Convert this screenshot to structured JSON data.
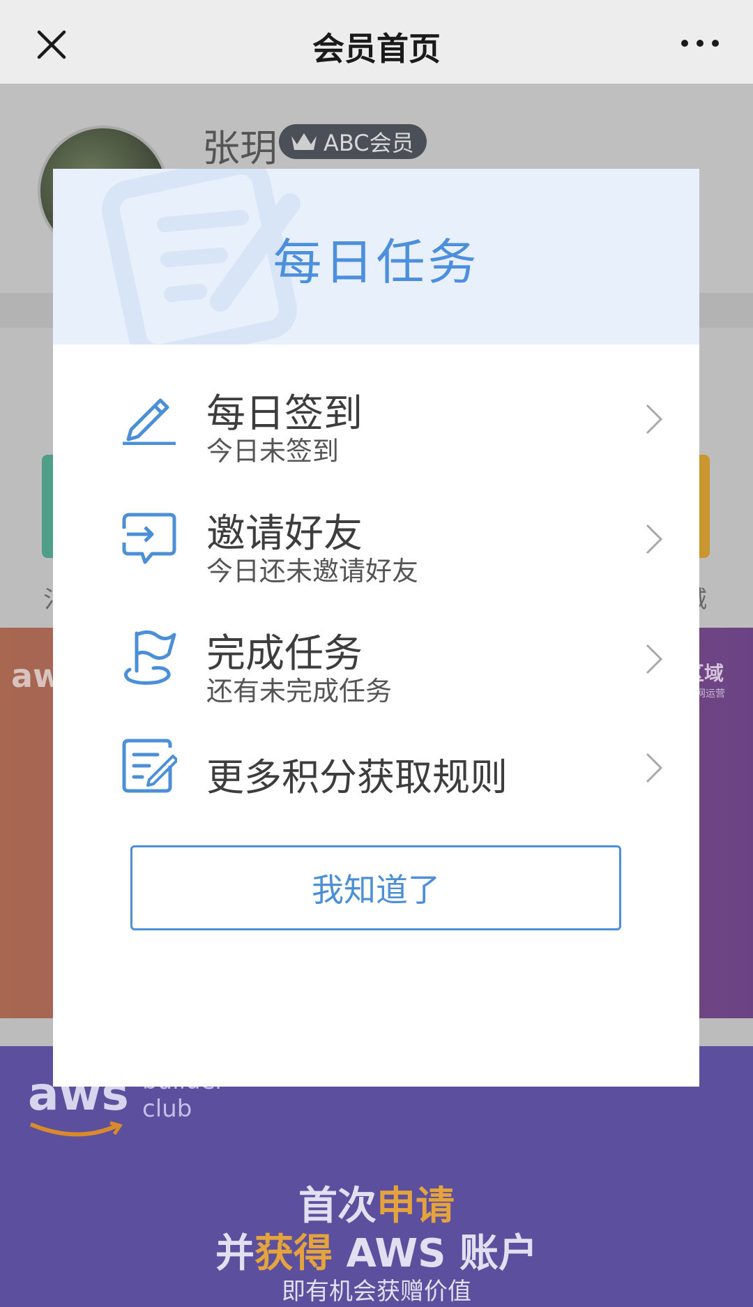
{
  "nav": {
    "title": "会员首页"
  },
  "profile": {
    "name": "张玥",
    "badge": "ABC会员"
  },
  "shortcuts": {
    "left_peek": "氵",
    "right_peek": "城"
  },
  "banner1": {
    "brand": "aws",
    "region_label": "区域",
    "region_sub": "网运营"
  },
  "banner2": {
    "brand": "aws",
    "brand_sub": "builder\nclub",
    "line1_a": "首次",
    "line1_b": "申请",
    "line2_a": "并",
    "line2_b": "获得",
    "line2_c": " AWS 账户",
    "line3": "即有机会获赠价值"
  },
  "modal": {
    "title": "每日任务",
    "tasks": [
      {
        "title": "每日签到",
        "desc": "今日未签到",
        "icon": "pencil-icon"
      },
      {
        "title": "邀请好友",
        "desc": "今日还未邀请好友",
        "icon": "share-icon"
      },
      {
        "title": "完成任务",
        "desc": "还有未完成任务",
        "icon": "flag-icon"
      },
      {
        "title": "更多积分获取规则",
        "desc": "",
        "icon": "edit-note-icon"
      }
    ],
    "ok_button": "我知道了"
  },
  "colors": {
    "accent": "#4b8fd6",
    "header_bg": "#e8f0fb"
  }
}
